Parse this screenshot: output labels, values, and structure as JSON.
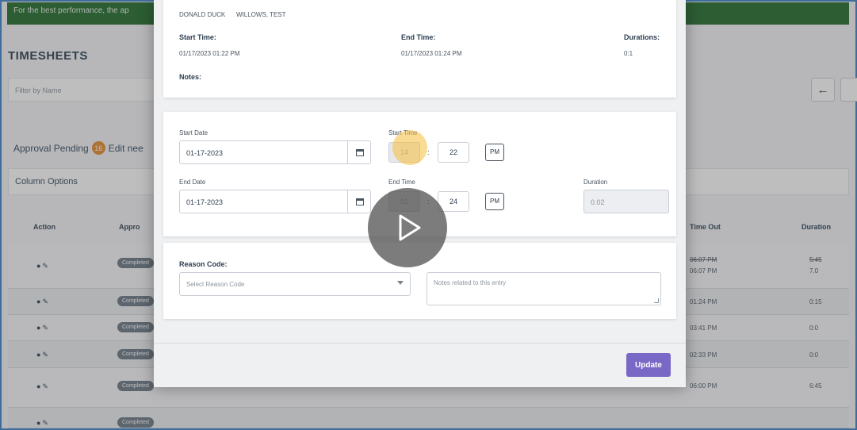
{
  "banner": {
    "text": "For the best performance, the ap"
  },
  "page": {
    "title": "TIMESHEETS",
    "filter_placeholder": "Filter by Name",
    "approval_label": "Approval Pending",
    "approval_count": "16",
    "edit_label": "Edit nee",
    "column_options": "Column Options"
  },
  "table": {
    "headers": {
      "action": "Action",
      "approval": "Appro",
      "time_out": "Time Out",
      "duration": "Duration"
    },
    "rows": [
      {
        "badge": "Completed",
        "time_out_old": "06:07 PM",
        "time_out": "06:07 PM",
        "duration_old": "5:45",
        "duration": "7.0"
      },
      {
        "badge": "Completed",
        "time_out": "01:24 PM",
        "duration": "0:15"
      },
      {
        "badge": "Completed",
        "time_out": "03:41 PM",
        "duration": "0:0"
      },
      {
        "badge": "Completed",
        "time_out": "02:33 PM",
        "duration": "0:0"
      },
      {
        "badge": "Completed",
        "time_out": "06:00 PM",
        "duration": "6:45"
      },
      {
        "badge": "Completed",
        "time_out": "",
        "duration": ""
      }
    ]
  },
  "modal": {
    "summary": {
      "employee": "DONALD DUCK",
      "manager": "WILLOWS, TEST",
      "start_label": "Start Time:",
      "start_value": "01/17/2023 01:22 PM",
      "end_label": "End Time:",
      "end_value": "01/17/2023 01:24 PM",
      "duration_label": "Durations:",
      "duration_value": "0:1",
      "notes_label": "Notes:"
    },
    "edit": {
      "start_date_label": "Start Date",
      "start_date_value": "01-17-2023",
      "start_time_label": "Start Time",
      "start_hour": "14",
      "start_minute": "22",
      "start_ampm": "PM",
      "end_date_label": "End Date",
      "end_date_value": "01-17-2023",
      "end_time_label": "End Time",
      "end_hour": "01",
      "end_minute": "24",
      "end_ampm": "PM",
      "duration_label": "Duration",
      "duration_value": "0.02",
      "time_separator": ":"
    },
    "reason": {
      "label": "Reason Code:",
      "select_placeholder": "Select Reason Code",
      "notes_placeholder": "Notes related to this entry"
    },
    "update_label": "Update"
  },
  "colors": {
    "accent": "#7a68c6",
    "banner": "#1f6b2a",
    "badge": "#e58a2c",
    "frame": "#3c83c9"
  }
}
